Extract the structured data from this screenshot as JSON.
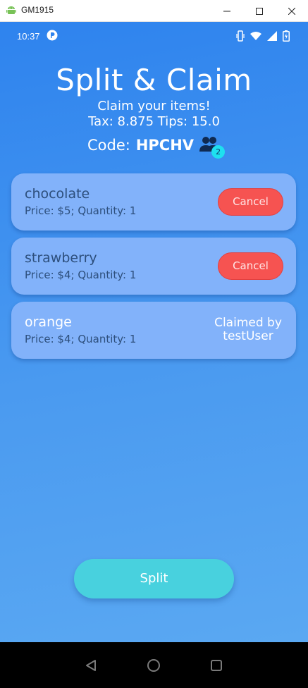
{
  "window": {
    "title": "GM1915"
  },
  "status_bar": {
    "time": "10:37"
  },
  "header": {
    "title": "Split & Claim",
    "subtitle": "Claim your items!",
    "tax_tips": "Tax: 8.875 Tips: 15.0",
    "code_label": "Code:",
    "code_value": "HPCHV",
    "participants_count": "2"
  },
  "items": [
    {
      "name": "chocolate",
      "detail": "Price: $5; Quantity: 1",
      "action_label": "Cancel"
    },
    {
      "name": "strawberry",
      "detail": "Price: $4; Quantity: 1",
      "action_label": "Cancel"
    },
    {
      "name": "orange",
      "detail": "Price: $4; Quantity: 1",
      "claimed_line1": "Claimed by",
      "claimed_line2": "testUser"
    }
  ],
  "split_button": {
    "label": "Split"
  },
  "colors": {
    "background_top": "#2e83ee",
    "background_bottom": "#5aa8f2",
    "card": "#82b2fa",
    "cancel_button": "#f65351",
    "split_button": "#48d1de",
    "badge": "#1ee0ef"
  }
}
